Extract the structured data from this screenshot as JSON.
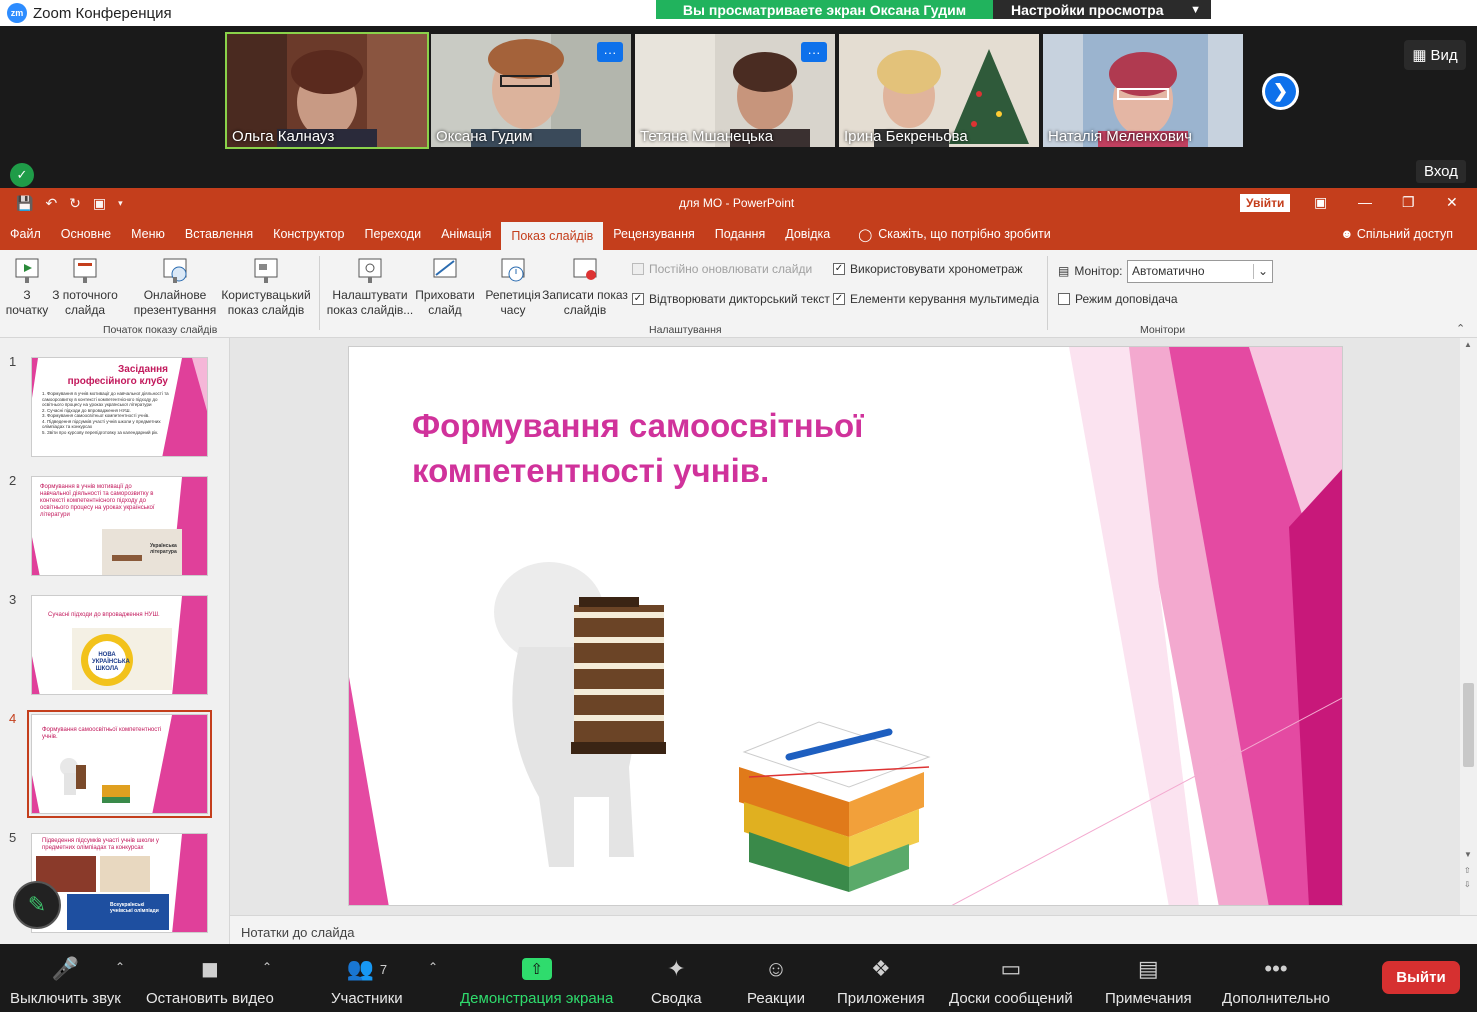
{
  "zoom": {
    "title": "Zoom Конференция",
    "logo": "zm",
    "share_banner": "Вы просматриваете экран Оксана Гудим",
    "view_settings": "Настройки просмотра",
    "view_button": "Вид",
    "enter_button": "Вход",
    "participants": [
      {
        "name": "Ольга Калнауз"
      },
      {
        "name": "Оксана Гудим"
      },
      {
        "name": "Тетяна Мшанецька"
      },
      {
        "name": "Ірина  Бекреньова"
      },
      {
        "name": "Наталія Меленхович"
      }
    ],
    "toolbar": {
      "mute": "Выключить звук",
      "stop_video": "Остановить видео",
      "participants": "Участники",
      "participants_count": "7",
      "share_screen": "Демонстрация экрана",
      "summary": "Сводка",
      "reactions": "Реакции",
      "apps": "Приложения",
      "whiteboards": "Доски сообщений",
      "notes": "Примечания",
      "more": "Дополнительно",
      "leave": "Выйти"
    }
  },
  "ppt": {
    "doc_title": "для МО  -  PowerPoint",
    "login": "Увійти",
    "tabs": [
      "Файл",
      "Основне",
      "Меню",
      "Вставлення",
      "Конструктор",
      "Переходи",
      "Анімація",
      "Показ слайдів",
      "Рецензування",
      "Подання",
      "Довідка"
    ],
    "tell_me": "Скажіть, що потрібно зробити",
    "share_access": "Спільний доступ",
    "ribbon": {
      "from_start": "З\nпочатку",
      "from_current": "З поточного\nслайда",
      "online": "Онлайнове\nпрезентування",
      "custom": "Користувацький\nпоказ слайдів",
      "group_start": "Початок показу слайдів",
      "setup": "Налаштувати\nпоказ слайдів...",
      "hide": "Приховати\nслайд",
      "rehearse": "Репетиція\nчасу",
      "record": "Записати показ\nслайдів",
      "chk_update": "Постійно оновлювати слайди",
      "chk_narration": "Відтворювати дикторський текст",
      "chk_timings": "Використовувати хронометраж",
      "chk_media": "Елементи керування мультимедіа",
      "group_setup": "Налаштування",
      "monitor_label": "Монітор:",
      "monitor_value": "Автоматично",
      "presenter_view": "Режим доповідача",
      "group_monitors": "Монітори"
    },
    "thumbnails": [
      {
        "num": "1",
        "title": "Засідання професійного клубу",
        "items": [
          "1. Формування в учнів мотивації до навчальної діяльності та самоорозвитку в контексті компетентнісного підходу до освітнього  процесу на уроках української літератури",
          "2. Сучасні підходи до впровадження НУШ.",
          "3. Формування самоосвітньої компетентності учнів.",
          "4. Підведення підсумків участі учнів школи у предметних олімпіадах та конкурсах",
          "5. Звіти про курсову перепідготовку за календарний рік."
        ]
      },
      {
        "num": "2",
        "text": "Формування в учнів мотивації до навчальної діяльності та саморозвитку в контексті компетентнісного підходу до освітнього  процесу на уроках української літератури",
        "img_label": "Українська література"
      },
      {
        "num": "3",
        "text": "Сучасні підходи до впровадження НУШ.",
        "img_label": "НОВА УКРАЇНСЬКА ШКОЛА"
      },
      {
        "num": "4",
        "text": "Формування самоосвітньої компетентності учнів."
      },
      {
        "num": "5",
        "text": "Підведення підсумків участі учнів школи у предметних олімпіадах та конкурсах",
        "img_label": "Всеукраїнські учнівські олімпіади"
      }
    ],
    "slide_title_line1": "Формування самоосвітньої",
    "slide_title_line2": "компетентності учнів.",
    "notes": "Нотатки до слайда"
  }
}
